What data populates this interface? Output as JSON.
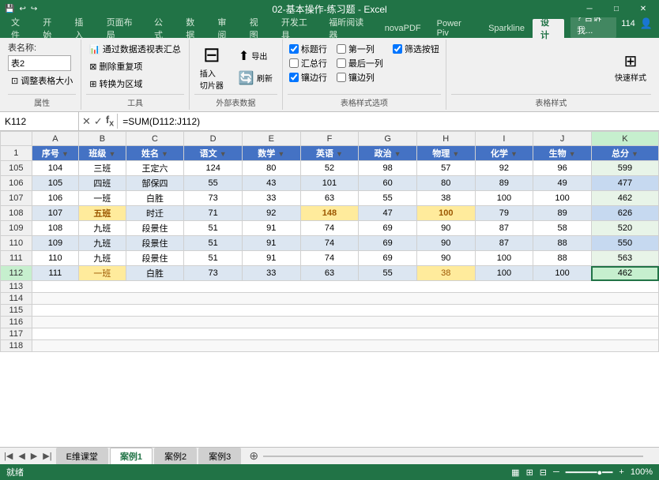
{
  "titleBar": {
    "title": "02-基本操作-练习题 - Excel",
    "quickAccess": [
      "💾",
      "↩",
      "↪"
    ],
    "windowControls": [
      "─",
      "□",
      "✕"
    ]
  },
  "ribbonTabs": [
    "文件",
    "开始",
    "插入",
    "页面布局",
    "公式",
    "数据",
    "审阅",
    "视图",
    "开发工具",
    "福昕阅读器",
    "novaPDF",
    "Power Piv",
    "Sparkline",
    "设计"
  ],
  "activeTab": "设计",
  "helpText": "告诉我...",
  "userCount": "114",
  "ribbonGroups": {
    "properties": {
      "label": "属性",
      "tableName": "表名称:",
      "tableNameValue": "表2",
      "resizeBtn": "调整表格大小"
    },
    "tools": {
      "label": "工具",
      "buttons": [
        "通过数据透视表汇总",
        "删除重复项",
        "转换为区域"
      ]
    },
    "externalData": {
      "label": "外部表数据",
      "buttons": [
        "插入切片器",
        "导出",
        "刷新"
      ]
    },
    "tableStyleOptions": {
      "label": "表格样式选项",
      "checkboxes": [
        "标题行",
        "汇总行",
        "镶边行",
        "第一列",
        "最后一列",
        "镶边列",
        "筛选按钮"
      ]
    },
    "tableStyles": {
      "label": "表格样式",
      "button": "快速样式"
    }
  },
  "formulaBar": {
    "nameBox": "K112",
    "formula": "=SUM(D112:J112)"
  },
  "columnHeaders": [
    "",
    "A",
    "B",
    "C",
    "D",
    "E",
    "F",
    "G",
    "H",
    "I",
    "J",
    "K"
  ],
  "headerLabels": [
    "序号",
    "班级",
    "姓名",
    "语文",
    "数学",
    "英语",
    "政治",
    "物理",
    "化学",
    "生物",
    "总分"
  ],
  "rows": [
    {
      "rowNum": "1",
      "isHeader": true,
      "cells": [
        "序号",
        "班级",
        "姓名",
        "语文",
        "数学",
        "英语",
        "政治",
        "物理",
        "化学",
        "生物",
        "总分"
      ]
    },
    {
      "rowNum": "105",
      "cells": [
        "104",
        "三班",
        "王定六",
        "124",
        "80",
        "52",
        "98",
        "57",
        "92",
        "96",
        "599"
      ]
    },
    {
      "rowNum": "106",
      "cells": [
        "105",
        "四班",
        "郜保四",
        "55",
        "43",
        "101",
        "60",
        "80",
        "89",
        "49",
        "477"
      ]
    },
    {
      "rowNum": "107",
      "cells": [
        "106",
        "一班",
        "白胜",
        "73",
        "33",
        "63",
        "55",
        "38",
        "100",
        "100",
        "462"
      ]
    },
    {
      "rowNum": "108",
      "cells": [
        "107",
        "五班",
        "时迁",
        "71",
        "92",
        "148",
        "47",
        "100",
        "79",
        "89",
        "626"
      ]
    },
    {
      "rowNum": "109",
      "cells": [
        "108",
        "九班",
        "段景住",
        "51",
        "91",
        "74",
        "69",
        "90",
        "87",
        "58",
        "520"
      ]
    },
    {
      "rowNum": "110",
      "cells": [
        "109",
        "九班",
        "段景住",
        "51",
        "91",
        "74",
        "69",
        "90",
        "87",
        "88",
        "550"
      ]
    },
    {
      "rowNum": "111",
      "cells": [
        "110",
        "九班",
        "段景住",
        "51",
        "91",
        "74",
        "69",
        "90",
        "100",
        "88",
        "563"
      ]
    },
    {
      "rowNum": "112",
      "cells": [
        "111",
        "一班",
        "白胜",
        "73",
        "33",
        "63",
        "55",
        "38",
        "100",
        "100",
        "462"
      ],
      "isSelected": true
    },
    {
      "rowNum": "113",
      "cells": [
        "",
        "",
        "",
        "",
        "",
        "",
        "",
        "",
        "",
        "",
        ""
      ]
    },
    {
      "rowNum": "114",
      "cells": [
        "",
        "",
        "",
        "",
        "",
        "",
        "",
        "",
        "",
        "",
        ""
      ]
    },
    {
      "rowNum": "115",
      "cells": [
        "",
        "",
        "",
        "",
        "",
        "",
        "",
        "",
        "",
        "",
        ""
      ]
    },
    {
      "rowNum": "116",
      "cells": [
        "",
        "",
        "",
        "",
        "",
        "",
        "",
        "",
        "",
        "",
        ""
      ]
    },
    {
      "rowNum": "117",
      "cells": [
        "",
        "",
        "",
        "",
        "",
        "",
        "",
        "",
        "",
        "",
        ""
      ]
    },
    {
      "rowNum": "118",
      "cells": [
        "",
        "",
        "",
        "",
        "",
        "",
        "",
        "",
        "",
        "",
        ""
      ]
    }
  ],
  "highlightRows": {
    "108": [
      "五班",
      "100"
    ],
    "107": [
      "五班"
    ]
  },
  "sheets": [
    "E维课堂",
    "案例1",
    "案例2",
    "案例3"
  ],
  "activeSheet": "案例1",
  "statusBar": {
    "status": "就绪",
    "viewButtons": [
      "普通",
      "页面布局",
      "分页预览"
    ],
    "zoom": "100%"
  }
}
